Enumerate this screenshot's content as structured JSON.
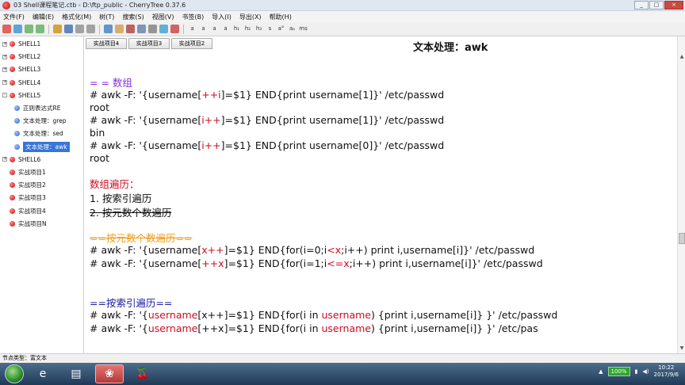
{
  "window": {
    "title": "03 Shell课程笔记.ctb - D:\\ftp_public - CherryTree 0.37.6",
    "buttons": [
      "_",
      "□",
      "×"
    ]
  },
  "menu": [
    "文件(F)",
    "编辑(E)",
    "格式化(M)",
    "树(T)",
    "搜索(S)",
    "视图(V)",
    "书签(B)",
    "导入(I)",
    "导出(X)",
    "帮助(H)"
  ],
  "toolbar": {
    "icons": [
      "pin-icon",
      "bookmark-icon",
      "arrow-left-icon",
      "arrow-right-icon",
      "add-node-icon",
      "save-icon",
      "undo-icon",
      "redo-icon",
      "list-icon",
      "paste-icon",
      "cut-icon",
      "table-icon",
      "code-icon",
      "link-icon",
      "anchor-icon",
      "bold-icon",
      "italic-icon",
      "underline-icon",
      "strike-icon",
      "h1-icon",
      "h2-icon",
      "h3-icon",
      "small-icon",
      "superscript-icon",
      "subscript-icon",
      "mono-icon"
    ],
    "labels": [
      "",
      "",
      "",
      "",
      "",
      "",
      "",
      "",
      "",
      "",
      "",
      "",
      "",
      "",
      "",
      "a",
      "a",
      "a",
      "a",
      "h₁",
      "h₂",
      "h₃",
      "s",
      "a°",
      "aₐ",
      "ms"
    ]
  },
  "sidebar": {
    "items": [
      {
        "label": "SHELL1",
        "level": 0,
        "dot": "red",
        "expander": "+"
      },
      {
        "label": "SHELL2",
        "level": 0,
        "dot": "red",
        "expander": "+"
      },
      {
        "label": "SHELL3",
        "level": 0,
        "dot": "red",
        "expander": "+"
      },
      {
        "label": "SHELL4",
        "level": 0,
        "dot": "red",
        "expander": "+"
      },
      {
        "label": "SHELL5",
        "level": 0,
        "dot": "red",
        "expander": "-"
      },
      {
        "label": "正则表达式RE",
        "level": 1,
        "dot": "blue",
        "expander": ""
      },
      {
        "label": "文本处理：grep",
        "level": 1,
        "dot": "blue",
        "expander": ""
      },
      {
        "label": "文本处理：sed",
        "level": 1,
        "dot": "blue",
        "expander": ""
      },
      {
        "label": "文本处理：awk",
        "level": 1,
        "dot": "blue",
        "expander": "",
        "selected": true
      },
      {
        "label": "SHELL6",
        "level": 0,
        "dot": "red",
        "expander": "+"
      },
      {
        "label": "实战项目1",
        "level": 0,
        "dot": "red",
        "expander": ""
      },
      {
        "label": "实战项目2",
        "level": 0,
        "dot": "red",
        "expander": ""
      },
      {
        "label": "实战项目3",
        "level": 0,
        "dot": "red",
        "expander": ""
      },
      {
        "label": "实战项目4",
        "level": 0,
        "dot": "red",
        "expander": ""
      },
      {
        "label": "实战项目N",
        "level": 0,
        "dot": "red",
        "expander": ""
      }
    ]
  },
  "tabs": [
    "实战项目4",
    "实战项目3",
    "实战项目2"
  ],
  "node_title": "文本处理：awk",
  "content": {
    "lines": [
      [
        {
          "t": "= = 数组",
          "c": "c-purple"
        }
      ],
      [
        {
          "t": "# awk -F: '{username["
        },
        {
          "t": "++i",
          "c": "c-red"
        },
        {
          "t": "]=$1} END{print username[1]}' /etc/passwd"
        }
      ],
      [
        {
          "t": "root"
        }
      ],
      [
        {
          "t": "# awk -F: '{username["
        },
        {
          "t": "i++",
          "c": "c-red"
        },
        {
          "t": "]=$1} END{print username[1]}' /etc/passwd"
        }
      ],
      [
        {
          "t": "bin"
        }
      ],
      [
        {
          "t": "# awk -F: '{username["
        },
        {
          "t": "i++",
          "c": "c-red"
        },
        {
          "t": "]=$1} END{print username[0]}' /etc/passwd"
        }
      ],
      [
        {
          "t": "root"
        }
      ],
      [
        {
          "t": "数组遍历：",
          "c": "c-red"
        }
      ],
      [
        {
          "t": "1. 按索引遍历"
        }
      ],
      [
        {
          "t": "2. 按元数个数遍历",
          "c": "strike"
        }
      ],
      [
        {
          "t": "==按元数个数遍历==",
          "c": "c-orange"
        }
      ],
      [
        {
          "t": "# awk -F: '{username["
        },
        {
          "t": "x++",
          "c": "c-red"
        },
        {
          "t": "]=$1} END{for(i=0;i"
        },
        {
          "t": "<x",
          "c": "c-red"
        },
        {
          "t": ";i++) print i,username[i]}' /etc/passwd"
        }
      ],
      [
        {
          "t": "# awk -F: '{username["
        },
        {
          "t": "++x",
          "c": "c-red"
        },
        {
          "t": "]=$1} END{for(i=1;i"
        },
        {
          "t": "<=x",
          "c": "c-red"
        },
        {
          "t": ";i++) print i,username[i]}' /etc/passwd"
        }
      ],
      [
        {
          "t": "==按索引遍历==",
          "c": "c-navy"
        }
      ],
      [
        {
          "t": "# awk -F: '{"
        },
        {
          "t": "username",
          "c": "c-red"
        },
        {
          "t": "[x++]=$1} END{for(i in "
        },
        {
          "t": "username",
          "c": "c-red"
        },
        {
          "t": ") {print i,username[i]} }' /etc/passwd"
        }
      ],
      [
        {
          "t": "# awk -F: '{"
        },
        {
          "t": "username",
          "c": "c-red"
        },
        {
          "t": "[++x]=$1} END{for(i in "
        },
        {
          "t": "username",
          "c": "c-red"
        },
        {
          "t": ") {print i,username[i]} }' /etc/pas"
        }
      ]
    ]
  },
  "statusbar": {
    "text": "节点类型：富文本"
  },
  "taskbar": {
    "apps": [
      {
        "name": "ie-icon",
        "glyph": "e"
      },
      {
        "name": "folder-icon",
        "glyph": "▤"
      },
      {
        "name": "cherrytree-app-icon",
        "glyph": "❀",
        "active": true
      },
      {
        "name": "cherry-icon",
        "glyph": "🍒"
      }
    ],
    "battery": "100%",
    "time": "10:22",
    "date": "2017/9/6"
  },
  "colors": {
    "accent": "#3875d7",
    "purple": "#8a2be2",
    "red": "#d20a20",
    "orange": "#f0a020",
    "navy": "#1a1aa6"
  }
}
